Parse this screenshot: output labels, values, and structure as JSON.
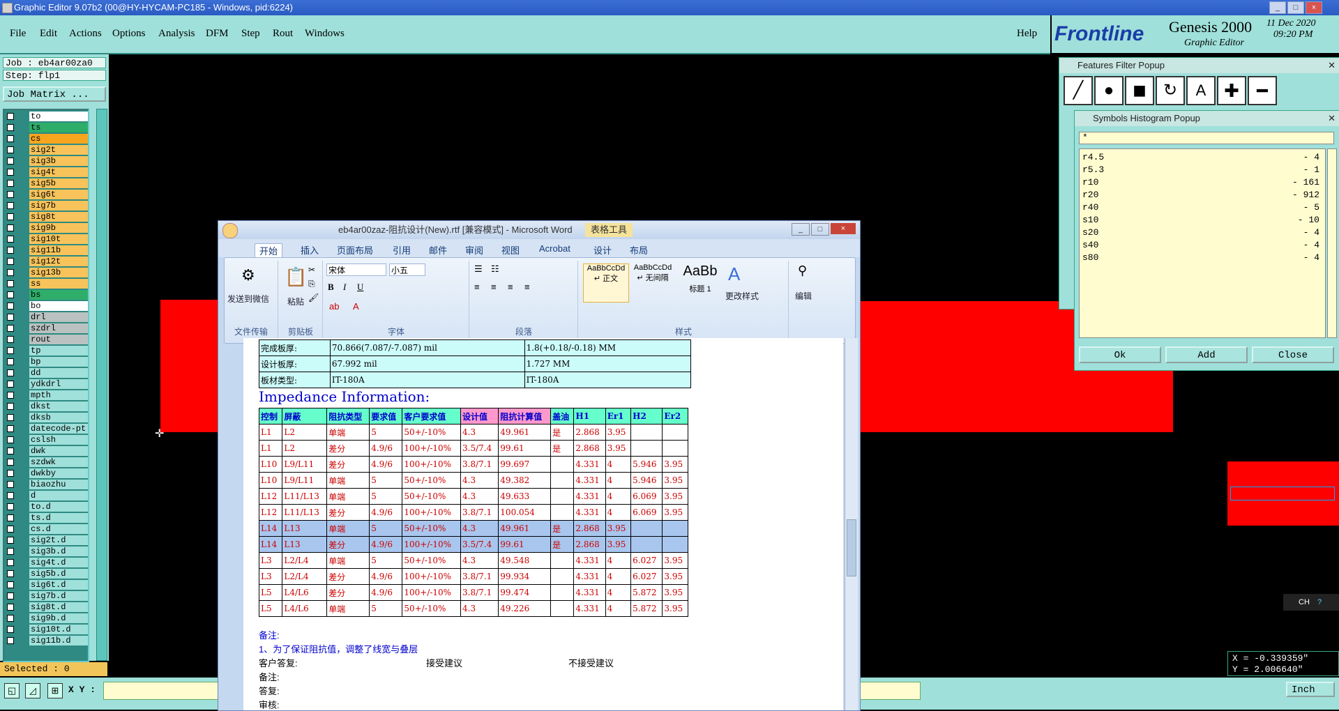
{
  "window": {
    "title": "Graphic Editor 9.07b2 (00@HY-HYCAM-PC185 - Windows, pid:6224)"
  },
  "menu": {
    "items": [
      "File",
      "Edit",
      "Actions",
      "Options",
      "Analysis",
      "DFM",
      "Step",
      "Rout",
      "Windows"
    ],
    "help": "Help"
  },
  "brand": {
    "logo": "Frontline",
    "product": "Genesis 2000",
    "subtitle": "Graphic Editor",
    "date": "11 Dec 2020",
    "time": "09:20 PM"
  },
  "job": {
    "job": "Job : eb4ar00za0",
    "step": "Step: flp1",
    "matrix_button": "Job Matrix ..."
  },
  "layers": [
    {
      "name": "to",
      "color": "#ffffff"
    },
    {
      "name": "ts",
      "color": "#2fae6a"
    },
    {
      "name": "cs",
      "color": "#f7a51f"
    },
    {
      "name": "sig2t",
      "color": "#f7c35a"
    },
    {
      "name": "sig3b",
      "color": "#f7c35a"
    },
    {
      "name": "sig4t",
      "color": "#f7c35a"
    },
    {
      "name": "sig5b",
      "color": "#f7c35a"
    },
    {
      "name": "sig6t",
      "color": "#f7c35a"
    },
    {
      "name": "sig7b",
      "color": "#f7c35a"
    },
    {
      "name": "sig8t",
      "color": "#f7c35a"
    },
    {
      "name": "sig9b",
      "color": "#f7c35a"
    },
    {
      "name": "sig10t",
      "color": "#f7c35a"
    },
    {
      "name": "sig11b",
      "color": "#f7c35a"
    },
    {
      "name": "sig12t",
      "color": "#f7c35a"
    },
    {
      "name": "sig13b",
      "color": "#f7c35a"
    },
    {
      "name": "ss",
      "color": "#f7c35a"
    },
    {
      "name": "bs",
      "color": "#2fae6a"
    },
    {
      "name": "bo",
      "color": "#ffffff"
    },
    {
      "name": "drl",
      "color": "#b9c2c0"
    },
    {
      "name": "szdrl",
      "color": "#b9c2c0"
    },
    {
      "name": "rout",
      "color": "#b9c2c0"
    },
    {
      "name": "tp",
      "color": "#9fe0da"
    },
    {
      "name": "bp",
      "color": "#9fe0da"
    },
    {
      "name": "dd",
      "color": "#9fe0da"
    },
    {
      "name": "ydkdrl",
      "color": "#9fe0da"
    },
    {
      "name": "mpth",
      "color": "#9fe0da"
    },
    {
      "name": "dkst",
      "color": "#9fe0da"
    },
    {
      "name": "dksb",
      "color": "#9fe0da"
    },
    {
      "name": "datecode-pt",
      "color": "#9fe0da"
    },
    {
      "name": "cslsh",
      "color": "#9fe0da"
    },
    {
      "name": "dwk",
      "color": "#9fe0da"
    },
    {
      "name": "szdwk",
      "color": "#9fe0da"
    },
    {
      "name": "dwkby",
      "color": "#9fe0da"
    },
    {
      "name": "biaozhu",
      "color": "#9fe0da"
    },
    {
      "name": "d",
      "color": "#9fe0da"
    },
    {
      "name": "to.d",
      "color": "#9fe0da"
    },
    {
      "name": "ts.d",
      "color": "#9fe0da"
    },
    {
      "name": "cs.d",
      "color": "#9fe0da"
    },
    {
      "name": "sig2t.d",
      "color": "#9fe0da"
    },
    {
      "name": "sig3b.d",
      "color": "#9fe0da"
    },
    {
      "name": "sig4t.d",
      "color": "#9fe0da"
    },
    {
      "name": "sig5b.d",
      "color": "#9fe0da"
    },
    {
      "name": "sig6t.d",
      "color": "#9fe0da"
    },
    {
      "name": "sig7b.d",
      "color": "#9fe0da"
    },
    {
      "name": "sig8t.d",
      "color": "#9fe0da"
    },
    {
      "name": "sig9b.d",
      "color": "#9fe0da"
    },
    {
      "name": "sig10t.d",
      "color": "#9fe0da"
    },
    {
      "name": "sig11b.d",
      "color": "#9fe0da"
    }
  ],
  "selected": "Selected : 0",
  "xy_label": "X Y :",
  "units": "Inch",
  "coords": {
    "x": "X = -0.339359\"",
    "y": "Y = 2.006640\""
  },
  "features_popup": {
    "title": "Features Filter Popup"
  },
  "histogram": {
    "title": "Symbols Histogram Popup",
    "filter": "*",
    "rows": [
      {
        "sym": "r4.5",
        "count": "-  4"
      },
      {
        "sym": "r5.3",
        "count": "-  1"
      },
      {
        "sym": "r10",
        "count": "-  161"
      },
      {
        "sym": "r20",
        "count": "-  912"
      },
      {
        "sym": "r40",
        "count": "-  5"
      },
      {
        "sym": "s10",
        "count": "-  10"
      },
      {
        "sym": "s20",
        "count": "-  4"
      },
      {
        "sym": "s40",
        "count": "-  4"
      },
      {
        "sym": "s80",
        "count": "-  4"
      }
    ],
    "buttons": [
      "Ok",
      "Add",
      "Close"
    ]
  },
  "ime": "CH",
  "word": {
    "title": "eb4ar00zaz-阻抗设计(New).rtf [兼容模式] - Microsoft Word",
    "context_tab": "表格工具",
    "tabs": [
      "开始",
      "插入",
      "页面布局",
      "引用",
      "邮件",
      "审阅",
      "视图",
      "Acrobat",
      "设计",
      "布局"
    ],
    "groups": [
      "文件传输",
      "剪贴板",
      "字体",
      "段落",
      "样式"
    ],
    "send_label": "发送到微信",
    "paste_label": "粘贴",
    "font": "宋体",
    "size": "小五",
    "styles": [
      {
        "preview": "AaBbCcDd",
        "name": "↵ 正文"
      },
      {
        "preview": "AaBbCcDd",
        "name": "↵ 无间隔"
      },
      {
        "preview": "AaBb",
        "name": "标题 1"
      }
    ],
    "change_style": "更改样式",
    "edit": "编辑",
    "top_rows": [
      [
        "完成板厚:",
        "70.866(7.087/-7.087) mil",
        "1.8(+0.18/-0.18) MM"
      ],
      [
        "设计板厚:",
        "67.992 mil",
        "1.727 MM"
      ],
      [
        "板材类型:",
        "IT-180A",
        "IT-180A"
      ]
    ],
    "heading": "Impedance Information:",
    "headers": [
      "控制",
      "屏蔽",
      "阻抗类型",
      "要求值",
      "客户要求值",
      "设计值",
      "阻抗计算值",
      "盖油",
      "H1",
      "Er1",
      "H2",
      "Er2"
    ],
    "rows": [
      [
        "L1",
        "L2",
        "单端",
        "5",
        "50+/-10%",
        "4.3",
        "49.961",
        "是",
        "2.868",
        "3.95",
        "",
        ""
      ],
      [
        "L1",
        "L2",
        "差分",
        "4.9/6",
        "100+/-10%",
        "3.5/7.4",
        "99.61",
        "是",
        "2.868",
        "3.95",
        "",
        ""
      ],
      [
        "L10",
        "L9/L11",
        "差分",
        "4.9/6",
        "100+/-10%",
        "3.8/7.1",
        "99.697",
        "",
        "4.331",
        "4",
        "5.946",
        "3.95"
      ],
      [
        "L10",
        "L9/L11",
        "单端",
        "5",
        "50+/-10%",
        "4.3",
        "49.382",
        "",
        "4.331",
        "4",
        "5.946",
        "3.95"
      ],
      [
        "L12",
        "L11/L13",
        "单端",
        "5",
        "50+/-10%",
        "4.3",
        "49.633",
        "",
        "4.331",
        "4",
        "6.069",
        "3.95"
      ],
      [
        "L12",
        "L11/L13",
        "差分",
        "4.9/6",
        "100+/-10%",
        "3.8/7.1",
        "100.054",
        "",
        "4.331",
        "4",
        "6.069",
        "3.95"
      ],
      [
        "L14",
        "L13",
        "单端",
        "5",
        "50+/-10%",
        "4.3",
        "49.961",
        "是",
        "2.868",
        "3.95",
        "",
        ""
      ],
      [
        "L14",
        "L13",
        "差分",
        "4.9/6",
        "100+/-10%",
        "3.5/7.4",
        "99.61",
        "是",
        "2.868",
        "3.95",
        "",
        ""
      ],
      [
        "L3",
        "L2/L4",
        "单端",
        "5",
        "50+/-10%",
        "4.3",
        "49.548",
        "",
        "4.331",
        "4",
        "6.027",
        "3.95"
      ],
      [
        "L3",
        "L2/L4",
        "差分",
        "4.9/6",
        "100+/-10%",
        "3.8/7.1",
        "99.934",
        "",
        "4.331",
        "4",
        "6.027",
        "3.95"
      ],
      [
        "L5",
        "L4/L6",
        "差分",
        "4.9/6",
        "100+/-10%",
        "3.8/7.1",
        "99.474",
        "",
        "4.331",
        "4",
        "5.872",
        "3.95"
      ],
      [
        "L5",
        "L4/L6",
        "单端",
        "5",
        "50+/-10%",
        "4.3",
        "49.226",
        "",
        "4.331",
        "4",
        "5.872",
        "3.95"
      ]
    ],
    "notes_label": "备注:",
    "note1": "1、为了保证阻抗值，调整了线宽与叠层",
    "reply": "客户答复:",
    "accept": "接受建议",
    "reject": "不接受建议",
    "notes2": "备注:",
    "answer": "答复:",
    "review": "审核:"
  }
}
